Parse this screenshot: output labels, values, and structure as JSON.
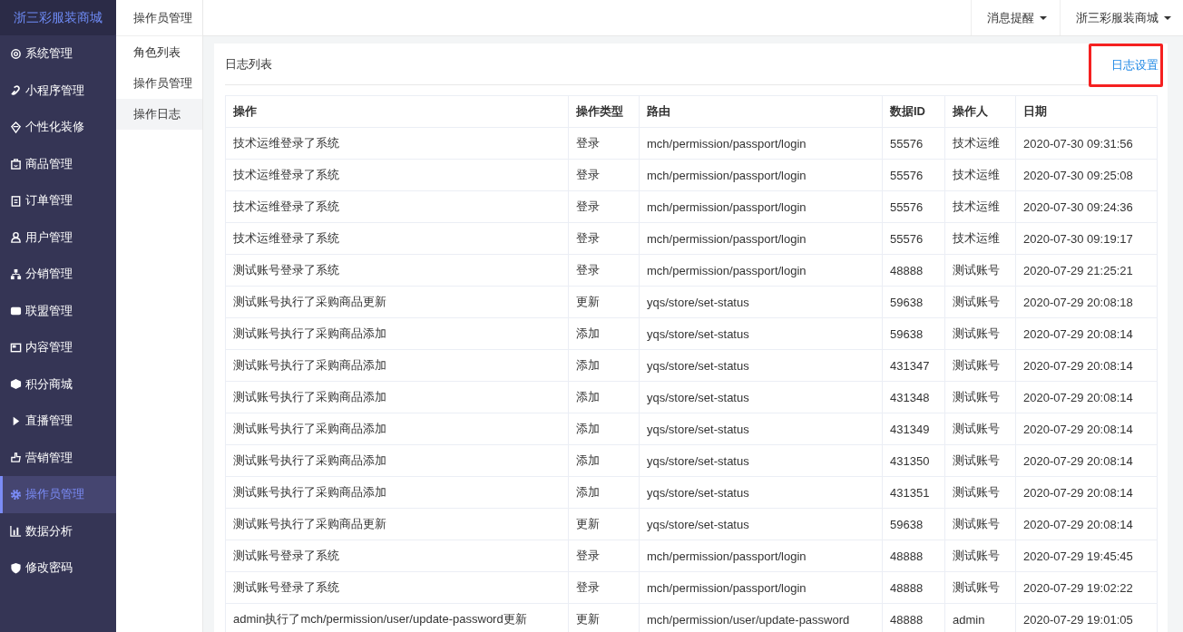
{
  "sidebar": {
    "logo": "浙三彩服装商城",
    "items": [
      {
        "label": "系统管理",
        "selected": false
      },
      {
        "label": "小程序管理",
        "selected": false
      },
      {
        "label": "个性化装修",
        "selected": false
      },
      {
        "label": "商品管理",
        "selected": false
      },
      {
        "label": "订单管理",
        "selected": false
      },
      {
        "label": "用户管理",
        "selected": false
      },
      {
        "label": "分销管理",
        "selected": false
      },
      {
        "label": "联盟管理",
        "selected": false
      },
      {
        "label": "内容管理",
        "selected": false
      },
      {
        "label": "积分商城",
        "selected": false
      },
      {
        "label": "直播管理",
        "selected": false
      },
      {
        "label": "营销管理",
        "selected": false
      },
      {
        "label": "操作员管理",
        "selected": true
      },
      {
        "label": "数据分析",
        "selected": false
      },
      {
        "label": "修改密码",
        "selected": false
      }
    ]
  },
  "submenu": {
    "title": "操作员管理",
    "items": [
      {
        "label": "角色列表",
        "selected": false
      },
      {
        "label": "操作员管理",
        "selected": false
      },
      {
        "label": "操作日志",
        "selected": true
      }
    ]
  },
  "header": {
    "menus": [
      "消息提醒",
      "浙三彩服装商城"
    ]
  },
  "card": {
    "title": "日志列表",
    "settings_link": {
      "label": "日志设置",
      "highlighted": true
    },
    "table": {
      "columns": [
        "操作",
        "操作类型",
        "路由",
        "数据ID",
        "操作人",
        "日期"
      ],
      "rows": [
        [
          "技术运维登录了系统",
          "登录",
          "mch/permission/passport/login",
          "55576",
          "技术运维",
          "2020-07-30 09:31:56"
        ],
        [
          "技术运维登录了系统",
          "登录",
          "mch/permission/passport/login",
          "55576",
          "技术运维",
          "2020-07-30 09:25:08"
        ],
        [
          "技术运维登录了系统",
          "登录",
          "mch/permission/passport/login",
          "55576",
          "技术运维",
          "2020-07-30 09:24:36"
        ],
        [
          "技术运维登录了系统",
          "登录",
          "mch/permission/passport/login",
          "55576",
          "技术运维",
          "2020-07-30 09:19:17"
        ],
        [
          "测试账号登录了系统",
          "登录",
          "mch/permission/passport/login",
          "48888",
          "测试账号",
          "2020-07-29 21:25:21"
        ],
        [
          "测试账号执行了采购商品更新",
          "更新",
          "yqs/store/set-status",
          "59638",
          "测试账号",
          "2020-07-29 20:08:18"
        ],
        [
          "测试账号执行了采购商品添加",
          "添加",
          "yqs/store/set-status",
          "59638",
          "测试账号",
          "2020-07-29 20:08:14"
        ],
        [
          "测试账号执行了采购商品添加",
          "添加",
          "yqs/store/set-status",
          "431347",
          "测试账号",
          "2020-07-29 20:08:14"
        ],
        [
          "测试账号执行了采购商品添加",
          "添加",
          "yqs/store/set-status",
          "431348",
          "测试账号",
          "2020-07-29 20:08:14"
        ],
        [
          "测试账号执行了采购商品添加",
          "添加",
          "yqs/store/set-status",
          "431349",
          "测试账号",
          "2020-07-29 20:08:14"
        ],
        [
          "测试账号执行了采购商品添加",
          "添加",
          "yqs/store/set-status",
          "431350",
          "测试账号",
          "2020-07-29 20:08:14"
        ],
        [
          "测试账号执行了采购商品添加",
          "添加",
          "yqs/store/set-status",
          "431351",
          "测试账号",
          "2020-07-29 20:08:14"
        ],
        [
          "测试账号执行了采购商品更新",
          "更新",
          "yqs/store/set-status",
          "59638",
          "测试账号",
          "2020-07-29 20:08:14"
        ],
        [
          "测试账号登录了系统",
          "登录",
          "mch/permission/passport/login",
          "48888",
          "测试账号",
          "2020-07-29 19:45:45"
        ],
        [
          "测试账号登录了系统",
          "登录",
          "mch/permission/passport/login",
          "48888",
          "测试账号",
          "2020-07-29 19:02:22"
        ],
        [
          "admin执行了mch/permission/user/update-password更新",
          "更新",
          "mch/permission/user/update-password",
          "48888",
          "admin",
          "2020-07-29 19:01:05"
        ]
      ]
    }
  }
}
